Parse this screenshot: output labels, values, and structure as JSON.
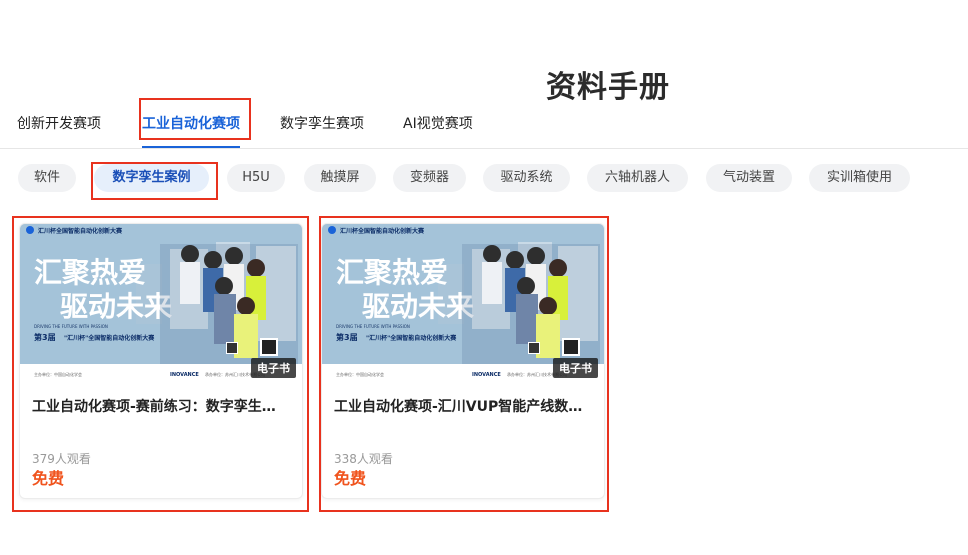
{
  "page": {
    "title": "资料手册"
  },
  "main_tabs": [
    {
      "label": "创新开发赛项"
    },
    {
      "label": "工业自动化赛项"
    },
    {
      "label": "数字孪生赛项"
    },
    {
      "label": "AI视觉赛项"
    }
  ],
  "main_tabs_active_index": 1,
  "filter_chips": [
    {
      "label": "软件"
    },
    {
      "label": "数字孪生案例"
    },
    {
      "label": "H5U"
    },
    {
      "label": "触摸屏"
    },
    {
      "label": "变频器"
    },
    {
      "label": "驱动系统"
    },
    {
      "label": "六轴机器人"
    },
    {
      "label": "气动装置"
    },
    {
      "label": "实训箱使用"
    }
  ],
  "filter_chips_active_index": 1,
  "cover": {
    "header": "汇川杯全国智能自动化创新大赛",
    "headline_line1": "汇聚热爱",
    "headline_line2": "驱动未来",
    "slogan": "DRIVING THE FUTURE WITH PASSION",
    "edition_prefix": "第3届",
    "edition_rest": "\"汇川杯\"全国智能自动化创新大赛",
    "footer_left": "主办单位：中国自动化学会",
    "footer_mid": "INOVANCE",
    "footer_right": "承办单位：苏州汇川技术有限公司"
  },
  "cards": [
    {
      "badge": "电子书",
      "title": "工业自动化赛项-赛前练习：数字孪生案例",
      "views": "379人观看",
      "price": "免费"
    },
    {
      "badge": "电子书",
      "title": "工业自动化赛项-汇川VUP智能产线数字孪生",
      "views": "338人观看",
      "price": "免费"
    }
  ],
  "colors": {
    "accent_blue": "#1a63d8",
    "price_orange": "#f0541e",
    "highlight_red": "#e8321e",
    "chip_bg": "#f1f2f4"
  }
}
